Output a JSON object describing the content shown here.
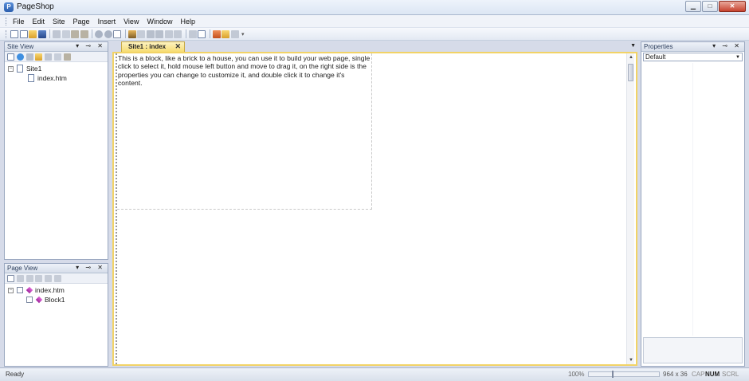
{
  "app": {
    "title": "PageShop"
  },
  "window_controls": {
    "minimize": "▁",
    "maximize": "□",
    "close": "✕"
  },
  "menu": [
    "File",
    "Edit",
    "Site",
    "Page",
    "Insert",
    "View",
    "Window",
    "Help"
  ],
  "site_view": {
    "title": "Site View",
    "controls": "▾ ⊸ ✕",
    "tree": [
      {
        "label": "Site1",
        "expander": "⊟",
        "level": 0
      },
      {
        "label": "index.htm",
        "level": 1
      }
    ]
  },
  "page_view": {
    "title": "Page View",
    "controls": "▾ ⊸ ✕",
    "tree": [
      {
        "label": "index.htm",
        "expander": "⊟",
        "level": 0
      },
      {
        "label": "Block1",
        "level": 1
      }
    ]
  },
  "editor": {
    "tab_label": "Site1 : index",
    "tab_close": "✕",
    "tab_dropdown": "▼",
    "block_text": "This is a block, like a brick to a house, you can use it to build your web page, single click to select it, hold mouse left button and move to drag it, on the right side is the properties you can change to customize it, and double click it to change it's content."
  },
  "properties": {
    "title": "Properties",
    "controls": "▾ ⊸ ✕",
    "selected": "Default",
    "dropdown_icon": "▼"
  },
  "status": {
    "ready": "Ready",
    "zoom": "100%",
    "zoom_level": 0.33,
    "size": "964 x 36",
    "cap": "CAP",
    "num": "NUM",
    "scrl": "SCRL"
  },
  "scroll": {
    "up": "▲",
    "down": "▼"
  },
  "icons": {
    "toolbar": [
      "new-page-icon",
      "new-site-icon",
      "open-icon",
      "save-icon",
      "cut-icon",
      "copy-icon",
      "paste-icon",
      "paste-special-icon",
      "undo-icon",
      "redo-icon",
      "insert-block-icon",
      "insert-image-icon",
      "insert-link-icon",
      "delete-icon",
      "clear-icon",
      "align-top-icon",
      "align-bottom-icon",
      "align-center-icon",
      "preview-icon",
      "publish-icon",
      "folder-icon",
      "fullscreen-icon"
    ],
    "site_tools": [
      "new-page-icon",
      "add-icon",
      "delete-icon",
      "open-icon",
      "cut-icon",
      "copy-icon",
      "paste-icon"
    ],
    "page_tools": [
      "new-block-icon",
      "edit-icon",
      "move-left-icon",
      "move-up-icon",
      "move-down-icon",
      "move-right-icon"
    ]
  },
  "colors": {
    "accent": "#f2d366",
    "panel_border": "#9aa8c0",
    "chrome": "#d6dbe9"
  }
}
